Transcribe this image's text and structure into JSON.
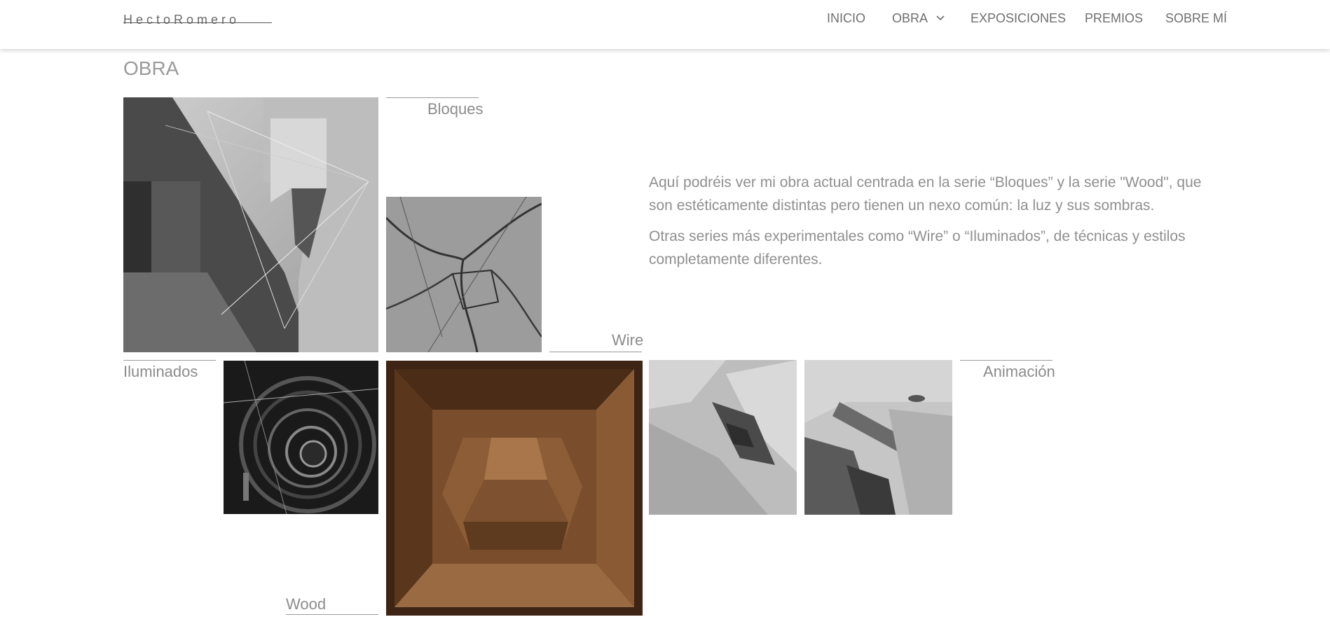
{
  "site": {
    "logo_text": "HectoRomero"
  },
  "nav": {
    "items": [
      {
        "label": "INICIO"
      },
      {
        "label": "OBRA",
        "has_dropdown": true
      },
      {
        "label": "EXPOSICIONES"
      },
      {
        "label": "PREMIOS"
      },
      {
        "label": "SOBRE MÍ"
      }
    ]
  },
  "page": {
    "title": "OBRA"
  },
  "series": {
    "bloques": "Bloques",
    "wire": "Wire",
    "iluminados": "Iluminados",
    "animacion": "Animación",
    "wood": "Wood"
  },
  "intro": {
    "p1": "Aquí podréis ver mi obra actual centrada en la serie “Bloques” y la serie \"Wood\", que son estéticamente distintas pero tienen un nexo común: la luz y sus sombras.",
    "p2": "Otras series más experimentales como “Wire” o “Iluminados”, de técnicas y estilos completamente diferentes."
  },
  "colors": {
    "text": "#8a8a8a",
    "nav_text": "#6f6f6f",
    "background": "#ffffff",
    "wood": "#7a4e2d"
  }
}
